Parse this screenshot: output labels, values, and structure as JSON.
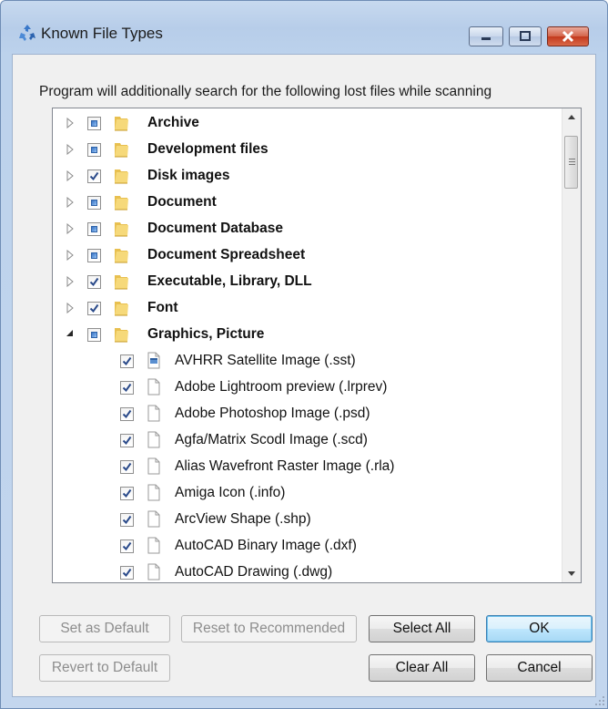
{
  "window": {
    "title": "Known File Types",
    "icon": "recycle-icon",
    "controls": [
      "minimize-icon",
      "maximize-icon",
      "close-icon"
    ],
    "accent_colors": {
      "titlebar": "#bcd2ec",
      "close_button": "#c3391d",
      "partial_check": "#3a75c4"
    }
  },
  "description": "Program will additionally search for the following lost files while scanning",
  "tree": {
    "rows": [
      {
        "label": "Archive",
        "type": "folder",
        "expanded": false,
        "state": "partial"
      },
      {
        "label": "Development files",
        "type": "folder",
        "expanded": false,
        "state": "partial"
      },
      {
        "label": "Disk images",
        "type": "folder",
        "expanded": false,
        "state": "checked"
      },
      {
        "label": "Document",
        "type": "folder",
        "expanded": false,
        "state": "partial"
      },
      {
        "label": "Document Database",
        "type": "folder",
        "expanded": false,
        "state": "partial"
      },
      {
        "label": "Document Spreadsheet",
        "type": "folder",
        "expanded": false,
        "state": "partial"
      },
      {
        "label": "Executable, Library, DLL",
        "type": "folder",
        "expanded": false,
        "state": "checked"
      },
      {
        "label": "Font",
        "type": "folder",
        "expanded": false,
        "state": "checked"
      },
      {
        "label": "Graphics, Picture",
        "type": "folder",
        "expanded": true,
        "state": "partial"
      },
      {
        "label": "AVHRR Satellite Image (.sst)",
        "type": "file",
        "icon": "app-file",
        "state": "checked"
      },
      {
        "label": "Adobe Lightroom preview (.lrprev)",
        "type": "file",
        "state": "checked"
      },
      {
        "label": "Adobe Photoshop Image (.psd)",
        "type": "file",
        "state": "checked"
      },
      {
        "label": "Agfa/Matrix Scodl Image (.scd)",
        "type": "file",
        "state": "checked"
      },
      {
        "label": "Alias Wavefront Raster Image (.rla)",
        "type": "file",
        "state": "checked"
      },
      {
        "label": "Amiga Icon (.info)",
        "type": "file",
        "state": "checked"
      },
      {
        "label": "ArcView Shape (.shp)",
        "type": "file",
        "state": "checked"
      },
      {
        "label": "AutoCAD Binary Image (.dxf)",
        "type": "file",
        "state": "checked"
      },
      {
        "label": "AutoCAD Drawing (.dwg)",
        "type": "file",
        "state": "checked"
      }
    ]
  },
  "buttons": {
    "set_default": "Set as Default",
    "reset_recommended": "Reset to Recommended",
    "select_all": "Select All",
    "ok": "OK",
    "revert_default": "Revert to Default",
    "clear_all": "Clear All",
    "cancel": "Cancel"
  }
}
